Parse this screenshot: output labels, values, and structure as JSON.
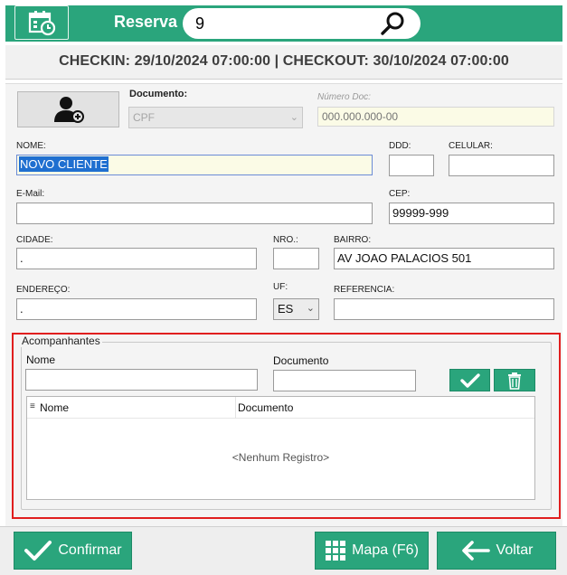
{
  "header": {
    "reserva_label": "Reserva",
    "reserva_value": "9",
    "calendar_icon": "calendar-clock-icon",
    "search_icon": "search-icon",
    "color": "#2aa57c"
  },
  "checkin_bar": {
    "text": "CHECKIN: 29/10/2024 07:00:00 | CHECKOUT: 30/10/2024 07:00:00"
  },
  "form": {
    "photo_icon": "user-add-icon",
    "documento_label": "Documento:",
    "documento_value": "CPF",
    "numero_doc_label": "Número Doc:",
    "numero_doc_placeholder": "000.000.000-00",
    "nome_label": "NOME:",
    "nome_value": "NOVO CLIENTE",
    "ddd_label": "DDD:",
    "ddd_value": "",
    "celular_label": "CELULAR:",
    "celular_value": "",
    "email_label": "E-Mail:",
    "email_value": "",
    "cep_label": "CEP:",
    "cep_value": "99999-999",
    "cidade_label": "CIDADE:",
    "cidade_value": ".",
    "nro_label": "NRO.:",
    "nro_value": "",
    "bairro_label": "BAIRRO:",
    "bairro_value": "AV JOAO  PALACIOS 501",
    "endereco_label": "ENDEREÇO:",
    "endereco_value": ".",
    "uf_label": "UF:",
    "uf_value": "ES",
    "referencia_label": "REFERENCIA:",
    "referencia_value": ""
  },
  "acompanhantes": {
    "title": "Acompanhantes",
    "nome_label": "Nome",
    "nome_value": "",
    "documento_label": "Documento",
    "documento_value": "",
    "confirm_icon": "check-icon",
    "delete_icon": "trash-icon",
    "grid": {
      "columns": [
        "Nome",
        "Documento"
      ],
      "rows": [],
      "empty_text": "<Nenhum Registro>"
    },
    "highlight_color": "#e01e1e"
  },
  "footer": {
    "confirmar_label": "Confirmar",
    "mapa_label": "Mapa (F6)",
    "voltar_label": "Voltar"
  }
}
